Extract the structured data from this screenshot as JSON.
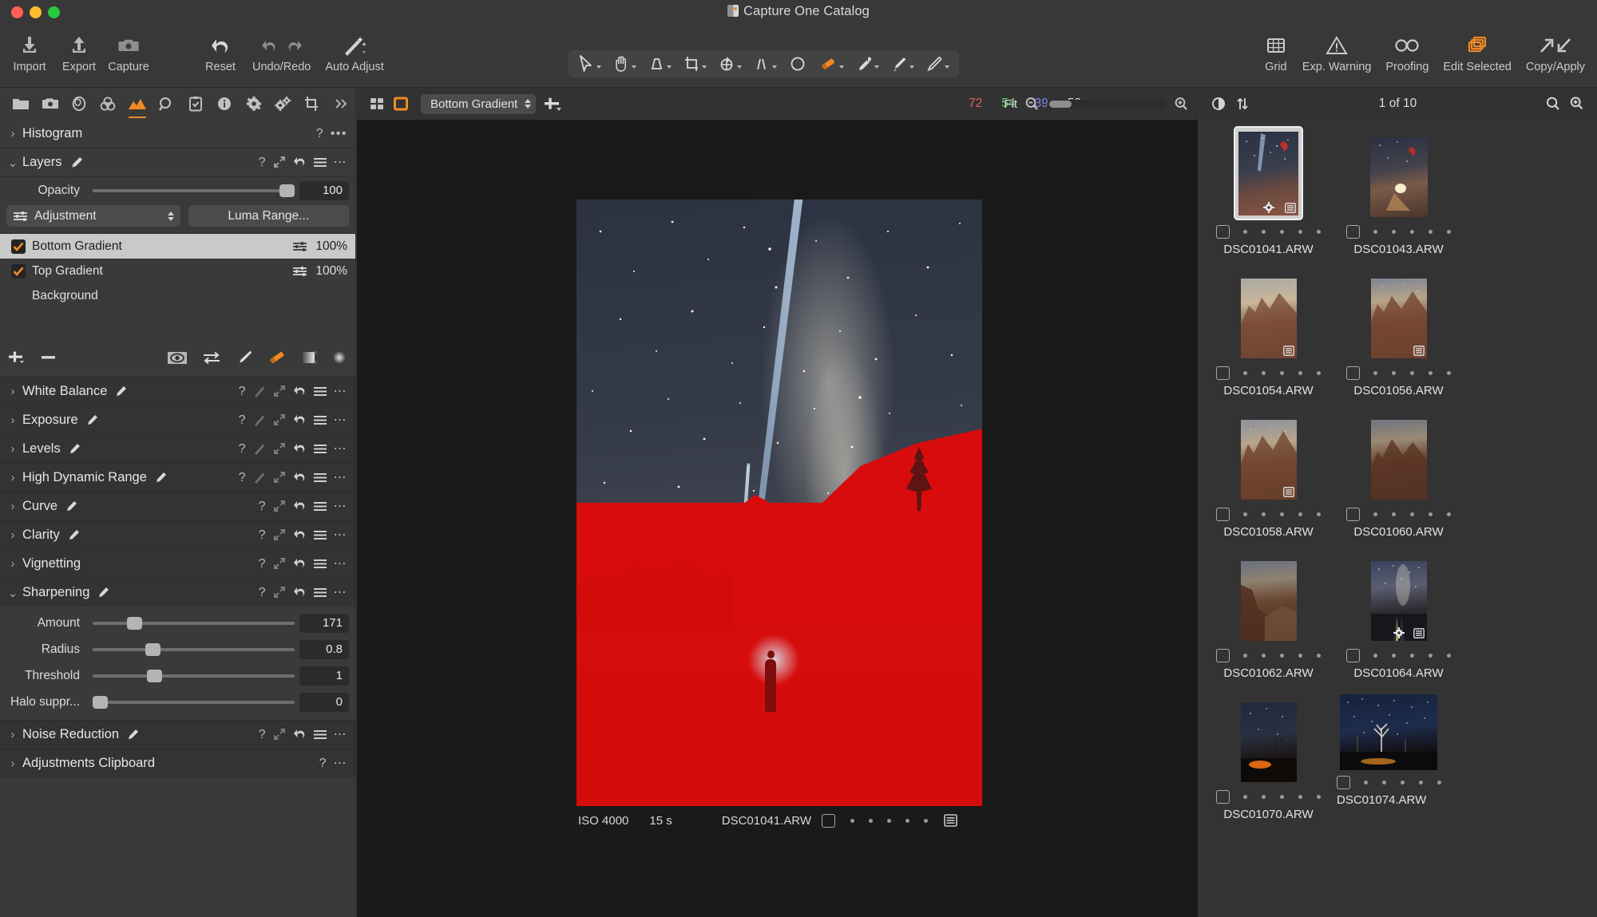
{
  "window": {
    "title": "Capture One Catalog"
  },
  "toolbar": {
    "left_items": [
      {
        "label": "Import",
        "icon": "import-icon"
      },
      {
        "label": "Export",
        "icon": "export-icon"
      },
      {
        "label": "Capture",
        "icon": "camera-icon"
      }
    ],
    "edit_items": [
      {
        "label": "Reset",
        "icon": "reset-arrow-icon"
      },
      {
        "label": "Undo/Redo",
        "icon": "undo-redo-icon"
      },
      {
        "label": "Auto Adjust",
        "icon": "magic-wand-icon"
      }
    ],
    "cursor_tools_label": "Cursor Tools",
    "cursor_tools": [
      {
        "name": "select-tool",
        "icon": "arrow-cursor-icon",
        "has_caret": true,
        "active": false
      },
      {
        "name": "pan-tool",
        "icon": "hand-icon",
        "has_caret": true,
        "active": false
      },
      {
        "name": "keystone-tool",
        "icon": "keystone-icon",
        "has_caret": true,
        "active": false
      },
      {
        "name": "crop-tool",
        "icon": "crop-icon",
        "has_caret": true,
        "active": false
      },
      {
        "name": "rotate-tool",
        "icon": "rotate-icon",
        "has_caret": true,
        "active": false
      },
      {
        "name": "straighten-tool",
        "icon": "straighten-icon",
        "has_caret": true,
        "active": false
      },
      {
        "name": "spot-removal-tool",
        "icon": "circle-icon",
        "has_caret": false,
        "active": false
      },
      {
        "name": "eraser-tool",
        "icon": "eraser-icon",
        "has_caret": true,
        "active": true
      },
      {
        "name": "white-balance-picker",
        "icon": "eyedropper-icon",
        "has_caret": true,
        "active": false
      },
      {
        "name": "gradient-mask-tool",
        "icon": "gradient-brush-icon",
        "has_caret": true,
        "active": false
      },
      {
        "name": "draw-mask-tool",
        "icon": "pen-icon",
        "has_caret": true,
        "active": false
      }
    ],
    "right_items": [
      {
        "label": "Grid",
        "icon": "grid-icon",
        "active": false
      },
      {
        "label": "Exp. Warning",
        "icon": "warning-triangle-icon",
        "active": false
      },
      {
        "label": "Proofing",
        "icon": "glasses-icon",
        "active": false
      },
      {
        "label": "Edit Selected",
        "icon": "stacked-layers-icon",
        "active": true
      },
      {
        "label": "Copy/Apply",
        "icon": "copy-apply-arrows-icon",
        "active": false
      }
    ]
  },
  "tool_tabs": [
    {
      "name": "library-tab",
      "icon": "folder-icon",
      "active": false
    },
    {
      "name": "capture-tab",
      "icon": "camera-icon",
      "active": false
    },
    {
      "name": "lens-tab",
      "icon": "lens-icon",
      "active": false
    },
    {
      "name": "color-tab",
      "icon": "color-circles-icon",
      "active": false
    },
    {
      "name": "exposure-tab",
      "icon": "exposure-mountain-icon",
      "active": true
    },
    {
      "name": "details-tab",
      "icon": "magnifier-icon",
      "active": false
    },
    {
      "name": "adjustments-tab",
      "icon": "clipboard-check-icon",
      "active": false
    },
    {
      "name": "metadata-tab",
      "icon": "info-icon",
      "active": false
    },
    {
      "name": "output-tab",
      "icon": "gear-icon",
      "active": false
    },
    {
      "name": "batch-tab",
      "icon": "gears-icon",
      "active": false
    },
    {
      "name": "crop-tab",
      "icon": "crop-icon",
      "active": false
    },
    {
      "name": "more-tabs",
      "icon": "chevron-double-right-icon",
      "active": false
    }
  ],
  "viewer_bar": {
    "view_mode_grid": "grid-view-icon",
    "view_mode_single": "single-view-icon",
    "layer_selector": {
      "value": "Bottom Gradient"
    },
    "add_layer": "plus-dropdown-icon",
    "readout": {
      "r": "72",
      "g": "54",
      "b": "39",
      "l": "58",
      "r_color": "#e06060",
      "g_color": "#5ec95e",
      "b_color": "#7a84e8",
      "l_color": "#dcdcdc"
    },
    "zoom_label": "Fit",
    "zoom_out_icon": "zoom-out-icon",
    "zoom_in_icon": "zoom-in-icon"
  },
  "browser_bar": {
    "preview_icon": "contrast-circle-icon",
    "sort_icon": "sort-arrows-icon",
    "count": "1 of 10",
    "search_icon": "search-icon",
    "zoom_icon": "thumb-zoom-icon"
  },
  "left_panel": {
    "histogram": {
      "title": "Histogram",
      "expanded": false,
      "help": "?",
      "more": "•••"
    },
    "layers": {
      "title": "Layers",
      "expanded": true,
      "opacity_label": "Opacity",
      "opacity_value": "100",
      "mode_value": "Adjustment",
      "luma_button": "Luma Range...",
      "items": [
        {
          "name": "Bottom Gradient",
          "checked": true,
          "opacity": "100%",
          "selected": true,
          "has_adjust_icon": true
        },
        {
          "name": "Top Gradient",
          "checked": true,
          "opacity": "100%",
          "selected": false,
          "has_adjust_icon": true
        },
        {
          "name": "Background",
          "checked": false,
          "opacity": "",
          "selected": false,
          "has_adjust_icon": false
        }
      ],
      "tools": [
        {
          "name": "add-layer-button",
          "icon": "plus-icon"
        },
        {
          "name": "remove-layer-button",
          "icon": "minus-icon"
        },
        {
          "name": "display-mask-button",
          "icon": "eye-icon",
          "active": true
        },
        {
          "name": "invert-mask-button",
          "icon": "invert-arrows-icon"
        },
        {
          "name": "draw-mask-brush-button",
          "icon": "brush-icon"
        },
        {
          "name": "erase-mask-button",
          "icon": "eraser-icon",
          "active": true
        },
        {
          "name": "linear-gradient-button",
          "icon": "linear-gradient-icon"
        },
        {
          "name": "radial-gradient-button",
          "icon": "radial-gradient-icon"
        }
      ]
    },
    "adjustments": [
      {
        "title": "White Balance",
        "expanded": false,
        "has_brush": true,
        "icons": [
          "?",
          "wand",
          "expand",
          "reset",
          "menu",
          "•••"
        ]
      },
      {
        "title": "Exposure",
        "expanded": false,
        "has_brush": true,
        "icons": [
          "?",
          "wand",
          "expand",
          "reset",
          "menu",
          "•••"
        ]
      },
      {
        "title": "Levels",
        "expanded": false,
        "has_brush": true,
        "icons": [
          "?",
          "wand",
          "expand",
          "reset",
          "menu",
          "•••"
        ]
      },
      {
        "title": "High Dynamic Range",
        "expanded": false,
        "has_brush": true,
        "icons": [
          "?",
          "wand",
          "expand",
          "reset",
          "menu",
          "•••"
        ]
      },
      {
        "title": "Curve",
        "expanded": false,
        "has_brush": true,
        "icons": [
          "?",
          "expand",
          "reset",
          "menu",
          "•••"
        ]
      },
      {
        "title": "Clarity",
        "expanded": false,
        "has_brush": true,
        "icons": [
          "?",
          "expand",
          "reset",
          "menu",
          "•••"
        ]
      },
      {
        "title": "Vignetting",
        "expanded": false,
        "has_brush": false,
        "icons": [
          "?",
          "expand",
          "reset",
          "menu",
          "•••"
        ]
      }
    ],
    "sharpening": {
      "title": "Sharpening",
      "expanded": true,
      "has_brush": true,
      "sliders": [
        {
          "label": "Amount",
          "value": "171",
          "pos": 17
        },
        {
          "label": "Radius",
          "value": "0.8",
          "pos": 26
        },
        {
          "label": "Threshold",
          "value": "1",
          "pos": 27
        },
        {
          "label": "Halo suppr...",
          "value": "0",
          "pos": 0
        }
      ]
    },
    "trailing": [
      {
        "title": "Noise Reduction",
        "expanded": false,
        "has_brush": true,
        "icons": [
          "?",
          "expand",
          "reset",
          "menu",
          "•••"
        ]
      },
      {
        "title": "Adjustments Clipboard",
        "expanded": false,
        "has_brush": false,
        "icons": [
          "?",
          "•••"
        ]
      }
    ]
  },
  "viewer": {
    "info_bar": {
      "iso": "ISO 4000",
      "shutter": "15 s",
      "filename": "DSC01041.ARW",
      "rating_dots": 5,
      "list_icon": "label-list-icon",
      "checkbox_icon": "checkbox-icon"
    }
  },
  "browser": {
    "thumbnails": [
      {
        "filename": "DSC01041.ARW",
        "selected": true,
        "orientation": "portrait",
        "has_gear": true,
        "has_label": true,
        "style": "t-a"
      },
      {
        "filename": "DSC01043.ARW",
        "selected": false,
        "orientation": "portrait",
        "has_gear": false,
        "has_label": false,
        "style": "t-b"
      },
      {
        "filename": "DSC01054.ARW",
        "selected": false,
        "orientation": "portrait",
        "has_gear": false,
        "has_label": true,
        "style": "t-c"
      },
      {
        "filename": "DSC01056.ARW",
        "selected": false,
        "orientation": "portrait",
        "has_gear": false,
        "has_label": true,
        "style": "t-d"
      },
      {
        "filename": "DSC01058.ARW",
        "selected": false,
        "orientation": "portrait",
        "has_gear": false,
        "has_label": true,
        "style": "t-e"
      },
      {
        "filename": "DSC01060.ARW",
        "selected": false,
        "orientation": "portrait",
        "has_gear": false,
        "has_label": false,
        "style": "t-f"
      },
      {
        "filename": "DSC01062.ARW",
        "selected": false,
        "orientation": "portrait",
        "has_gear": false,
        "has_label": false,
        "style": "t-g"
      },
      {
        "filename": "DSC01064.ARW",
        "selected": false,
        "orientation": "portrait",
        "has_gear": true,
        "has_label": true,
        "style": "t-h"
      },
      {
        "filename": "DSC01070.ARW",
        "selected": false,
        "orientation": "portrait",
        "has_gear": false,
        "has_label": false,
        "style": "t-i"
      },
      {
        "filename": "DSC01074.ARW",
        "selected": false,
        "orientation": "landscape",
        "has_gear": false,
        "has_label": false,
        "style": "t-j"
      }
    ]
  },
  "colors": {
    "accent": "#f08a24",
    "panel_bg": "#3a3a3a",
    "viewer_bg": "#1a1a1a",
    "browser_bg": "#333333",
    "selection": "#c9c9c9"
  }
}
